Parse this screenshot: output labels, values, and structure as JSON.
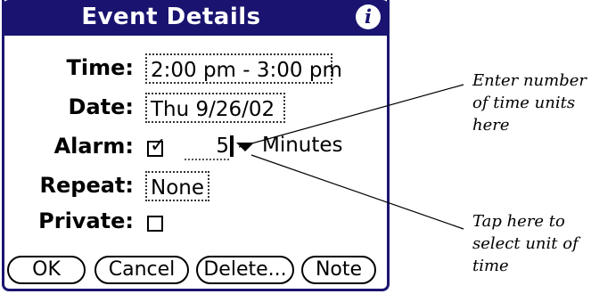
{
  "dialog": {
    "title": "Event Details",
    "info_icon_glyph": "i"
  },
  "rows": {
    "time": {
      "label": "Time:",
      "value": "2:00 pm - 3:00 pm"
    },
    "date": {
      "label": "Date:",
      "value": "Thu 9/26/02"
    },
    "alarm": {
      "label": "Alarm:",
      "checked": true,
      "value": "5",
      "unit": "Minutes"
    },
    "repeat": {
      "label": "Repeat:",
      "value": "None"
    },
    "private": {
      "label": "Private:",
      "checked": false
    }
  },
  "buttons": {
    "ok": "OK",
    "cancel": "Cancel",
    "delete": "Delete...",
    "note": "Note"
  },
  "callouts": {
    "number": "Enter number of time units here",
    "unit": "Tap here to select unit of time"
  },
  "colors": {
    "title_bar": "#1a1470"
  }
}
